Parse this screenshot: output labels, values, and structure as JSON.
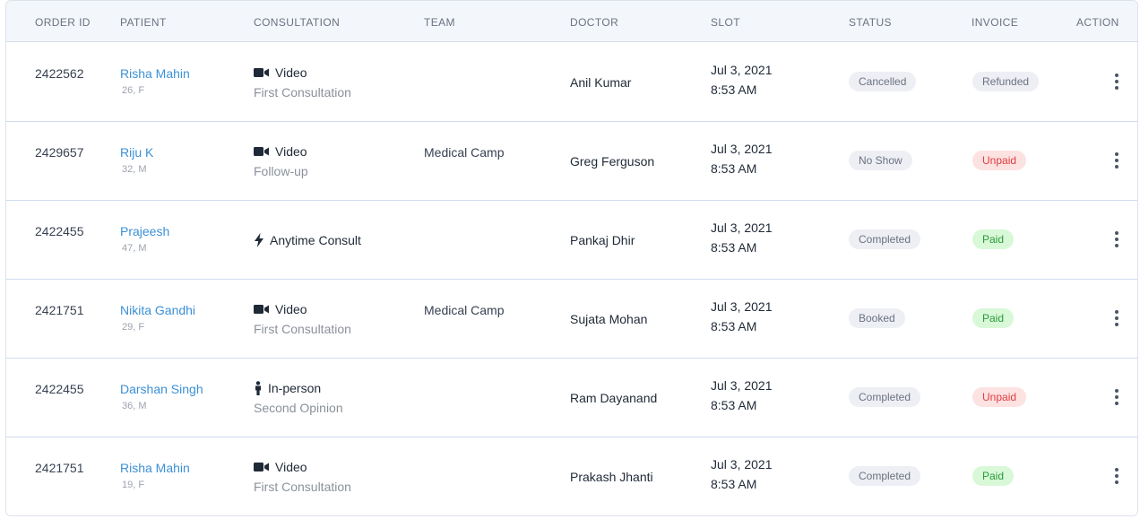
{
  "columns": {
    "order_id": "ORDER ID",
    "patient": "PATIENT",
    "consultation": "CONSULTATION",
    "team": "TEAM",
    "doctor": "DOCTOR",
    "slot": "SLOT",
    "status": "STATUS",
    "invoice": "INVOICE",
    "action": "ACTION"
  },
  "rows": [
    {
      "order_id": "2422562",
      "patient_name": "Risha Mahin",
      "patient_meta": "26, F",
      "consult_icon": "video-icon",
      "consult_type": "Video",
      "consult_sub": "First Consultation",
      "team": "",
      "doctor": "Anil Kumar",
      "slot_date": "Jul 3, 2021",
      "slot_time": "8:53 AM",
      "status": "Cancelled",
      "invoice": "Refunded",
      "invoice_tone": "neutral"
    },
    {
      "order_id": "2429657",
      "patient_name": "Riju K",
      "patient_meta": "32, M",
      "consult_icon": "video-icon",
      "consult_type": "Video",
      "consult_sub": "Follow-up",
      "team": "Medical Camp",
      "doctor": "Greg Ferguson",
      "slot_date": "Jul 3, 2021",
      "slot_time": "8:53 AM",
      "status": "No Show",
      "invoice": "Unpaid",
      "invoice_tone": "red"
    },
    {
      "order_id": "2422455",
      "patient_name": "Prajeesh",
      "patient_meta": "47, M",
      "consult_icon": "lightning-icon",
      "consult_type": "Anytime Consult",
      "consult_sub": "",
      "team": "",
      "doctor": "Pankaj Dhir",
      "slot_date": "Jul 3, 2021",
      "slot_time": "8:53 AM",
      "status": "Completed",
      "invoice": "Paid",
      "invoice_tone": "green"
    },
    {
      "order_id": "2421751",
      "patient_name": "Nikita Gandhi",
      "patient_meta": "29, F",
      "consult_icon": "video-icon",
      "consult_type": "Video",
      "consult_sub": "First Consultation",
      "team": "Medical Camp",
      "doctor": "Sujata Mohan",
      "slot_date": "Jul 3, 2021",
      "slot_time": "8:53 AM",
      "status": "Booked",
      "invoice": "Paid",
      "invoice_tone": "green"
    },
    {
      "order_id": "2422455",
      "patient_name": "Darshan Singh",
      "patient_meta": "36, M",
      "consult_icon": "person-icon",
      "consult_type": "In-person",
      "consult_sub": "Second Opinion",
      "team": "",
      "doctor": "Ram Dayanand",
      "slot_date": "Jul 3, 2021",
      "slot_time": "8:53 AM",
      "status": "Completed",
      "invoice": "Unpaid",
      "invoice_tone": "red"
    },
    {
      "order_id": "2421751",
      "patient_name": "Risha Mahin",
      "patient_meta": "19, F",
      "consult_icon": "video-icon",
      "consult_type": "Video",
      "consult_sub": "First Consultation",
      "team": "",
      "doctor": "Prakash Jhanti",
      "slot_date": "Jul 3, 2021",
      "slot_time": "8:53 AM",
      "status": "Completed",
      "invoice": "Paid",
      "invoice_tone": "green"
    }
  ],
  "colors": {
    "header_bg": "#f3f6fb",
    "link": "#3b90d6",
    "badge_neutral_bg": "#edeff4",
    "badge_red_bg": "#fde2e2",
    "badge_red_text": "#e03c3c",
    "badge_green_bg": "#d8f8d8",
    "badge_green_text": "#2b9a3a"
  }
}
